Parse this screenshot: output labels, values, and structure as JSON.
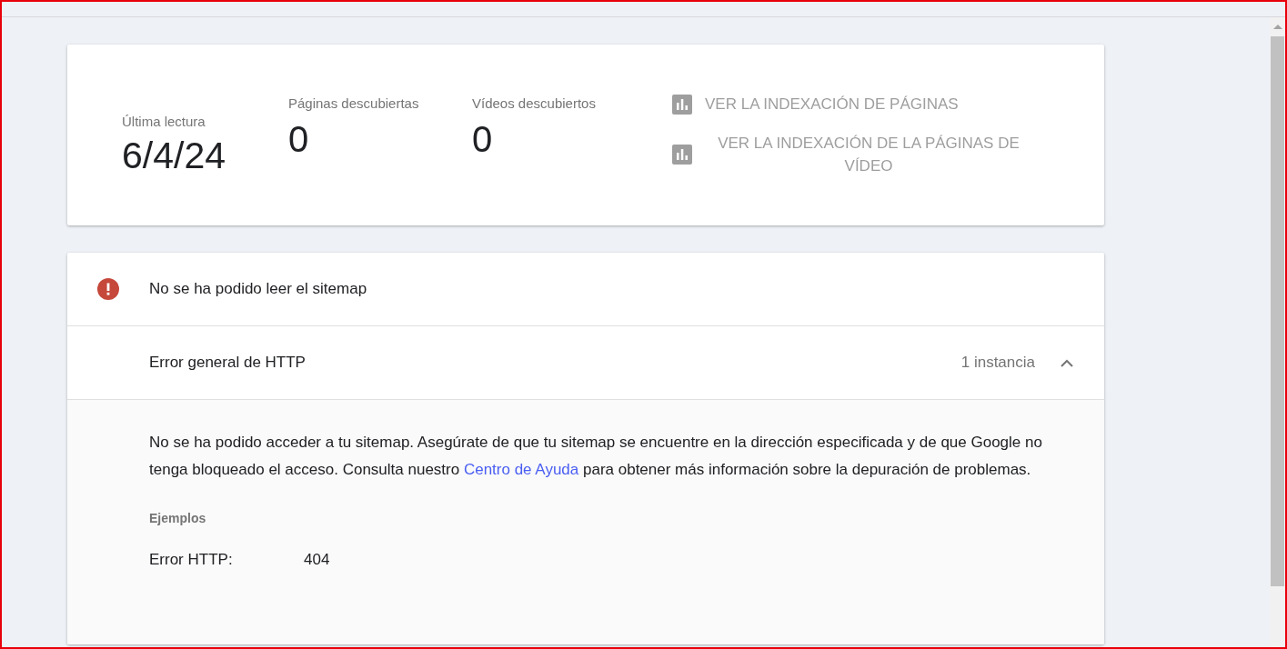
{
  "summary": {
    "stats": [
      {
        "label": "Última lectura",
        "value": "6/4/24"
      },
      {
        "label": "Páginas descubiertas",
        "value": "0"
      },
      {
        "label": "Vídeos descubiertos",
        "value": "0"
      }
    ],
    "links": [
      {
        "label": "VER LA INDEXACIÓN DE PÁGINAS"
      },
      {
        "label": "VER LA INDEXACIÓN DE LA PÁGINAS DE VÍDEO"
      }
    ]
  },
  "error_panel": {
    "title": "No se ha podido leer el sitemap",
    "issue": {
      "title": "Error general de HTTP",
      "count": "1 instancia",
      "expanded": true,
      "description_before": "No se ha podido acceder a tu sitemap. Asegúrate de que tu sitemap se encuentre en la dirección especificada y de que Google no tenga bloqueado el acceso. Consulta nuestro ",
      "link": "Centro de Ayuda",
      "description_after": " para obtener más información sobre la depuración de problemas.",
      "examples_heading": "Ejemplos",
      "examples": [
        {
          "label": "Error HTTP:",
          "value": "404"
        }
      ]
    }
  }
}
